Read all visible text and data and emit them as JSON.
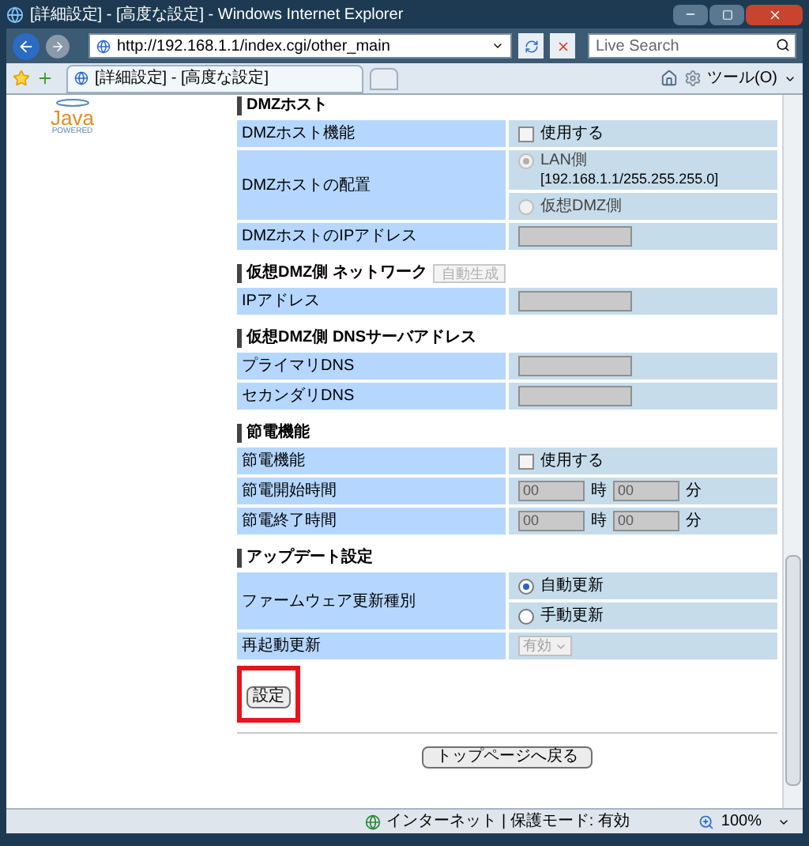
{
  "window": {
    "title": "[詳細設定] - [高度な設定] - Windows Internet Explorer"
  },
  "address_bar": {
    "url": "http://192.168.1.1/index.cgi/other_main"
  },
  "search": {
    "placeholder": "Live Search"
  },
  "tabs": [
    {
      "label": "[詳細設定] - [高度な設定]",
      "selected": true
    }
  ],
  "toolbar": {
    "tools_label": "ツール(O)"
  },
  "logo": {
    "name": "Java",
    "tagline": "POWERED"
  },
  "sections": [
    {
      "title": "DMZホスト",
      "rows": [
        {
          "label": "DMZホスト機能",
          "items": [
            {
              "kind": "checkbox",
              "label": "使用する",
              "checked": false
            }
          ]
        },
        {
          "label": "DMZホストの配置",
          "items": [
            {
              "kind": "radio",
              "label": "LAN側",
              "detail": "[192.168.1.1/255.255.255.0]",
              "selected": true,
              "disabled": true
            },
            {
              "kind": "radio",
              "label": "仮想DMZ側",
              "selected": false,
              "disabled": true
            }
          ]
        },
        {
          "label": "DMZホストのIPアドレス",
          "items": [
            {
              "kind": "input",
              "disabled": true
            }
          ]
        }
      ]
    },
    {
      "title": "仮想DMZ側 ネットワーク",
      "button": {
        "label": "自動生成",
        "disabled": true
      },
      "rows": [
        {
          "label": "IPアドレス",
          "items": [
            {
              "kind": "input",
              "disabled": true
            }
          ]
        }
      ]
    },
    {
      "title": "仮想DMZ側 DNSサーバアドレス",
      "rows": [
        {
          "label": "プライマリDNS",
          "items": [
            {
              "kind": "input",
              "disabled": true
            }
          ]
        },
        {
          "label": "セカンダリDNS",
          "items": [
            {
              "kind": "input",
              "disabled": true
            }
          ]
        }
      ]
    },
    {
      "title": "節電機能",
      "rows": [
        {
          "label": "節電機能",
          "items": [
            {
              "kind": "checkbox",
              "label": "使用する",
              "checked": false
            }
          ]
        },
        {
          "label": "節電開始時間",
          "items": [
            {
              "kind": "time",
              "hour_placeholder": "00",
              "hour_unit": "時",
              "minute_placeholder": "00",
              "minute_unit": "分",
              "disabled": true
            }
          ]
        },
        {
          "label": "節電終了時間",
          "items": [
            {
              "kind": "time",
              "hour_placeholder": "00",
              "hour_unit": "時",
              "minute_placeholder": "00",
              "minute_unit": "分",
              "disabled": true
            }
          ]
        }
      ]
    },
    {
      "title": "アップデート設定",
      "rows": [
        {
          "label": "ファームウェア更新種別",
          "items": [
            {
              "kind": "radio",
              "label": "自動更新",
              "selected": true,
              "disabled": false
            },
            {
              "kind": "radio",
              "label": "手動更新",
              "selected": false,
              "disabled": false
            }
          ]
        },
        {
          "label": "再起動更新",
          "items": [
            {
              "kind": "select",
              "value": "有効",
              "disabled": true
            }
          ]
        }
      ]
    }
  ],
  "submit_button": {
    "label": "設定",
    "highlighted": true
  },
  "back_button": {
    "label": "トップページへ戻る"
  },
  "status_bar": {
    "zone": "インターネット | 保護モード: 有効",
    "zoom": "100%"
  }
}
